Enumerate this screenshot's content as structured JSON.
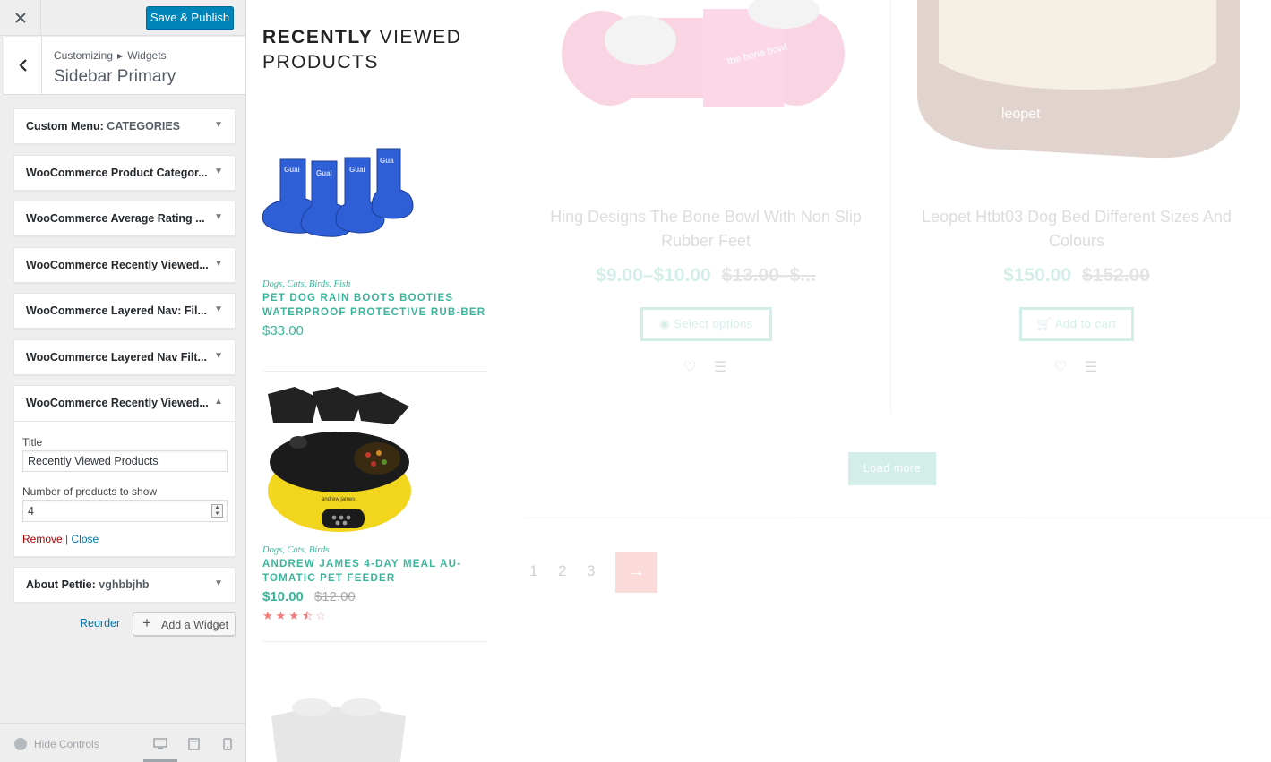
{
  "customizer": {
    "save_label": "Save & Publish",
    "breadcrumb": [
      "Customizing",
      "Widgets"
    ],
    "section_title": "Sidebar Primary",
    "widgets": [
      {
        "title": "Custom Menu:",
        "subtitle": "CATEGORIES"
      },
      {
        "title": "WooCommerce Product Categor...",
        "subtitle": ""
      },
      {
        "title": "WooCommerce Average Rating ...",
        "subtitle": ""
      },
      {
        "title": "WooCommerce Recently Viewed...",
        "subtitle": ""
      },
      {
        "title": "WooCommerce Layered Nav: Fil...",
        "subtitle": ""
      },
      {
        "title": "WooCommerce Layered Nav Filt...",
        "subtitle": ""
      },
      {
        "title": "WooCommerce Recently Viewed...",
        "subtitle": ""
      },
      {
        "title": "About Pettie:",
        "subtitle": "vghbbjhb"
      }
    ],
    "open_widget": {
      "title_label": "Title",
      "title_value": "Recently Viewed Products",
      "count_label": "Number of products to show",
      "count_value": "4",
      "remove_label": "Remove",
      "separator": "|",
      "close_label": "Close"
    },
    "reorder_label": "Reorder",
    "add_widget_label": "Add a Widget",
    "footer": {
      "hide_controls_label": "Hide Controls",
      "active_device": "desktop"
    }
  },
  "preview": {
    "recently_viewed": {
      "title_bold": "RECENTLY",
      "title_rest": " VIEWED PRODUCTS",
      "items": [
        {
          "categories": "Dogs, Cats, Birds, Fish",
          "name": "PET DOG RAIN BOOTS BOOTIES WATERPROOF PROTECTIVE RUB-BER",
          "price": "$33.00",
          "old_price": "",
          "image": "blue-rain-boots"
        },
        {
          "categories": "Dogs, Cats, Birds",
          "name": "ANDREW JAMES 4-DAY MEAL AU-TOMATIC PET FEEDER",
          "price": "$10.00",
          "old_price": "$12.00",
          "rating": 3.5,
          "image": "yellow-pet-feeder"
        }
      ]
    },
    "shop_grid": {
      "products": [
        {
          "name": "Hing Designs The Bone Bowl With Non Slip Rubber Feet",
          "price": "$9.00–$10.00",
          "old_price": "$13.00–$...",
          "button": "Select options",
          "button_icon": "eye-icon",
          "image_text": "the bone bowl"
        },
        {
          "name": "Leopet Htbt03 Dog Bed Different Sizes And Colours",
          "price": "$150.00",
          "old_price": "$152.00",
          "button": "Add to cart",
          "button_icon": "cart-icon",
          "image_text": "leopet"
        }
      ],
      "load_more": "Load more",
      "pages": [
        "1",
        "2",
        "3"
      ],
      "next_symbol": "→"
    },
    "colors": {
      "accent": "#3ab59b",
      "next_bg": "#f05a5a",
      "wp_blue": "#0085ba"
    }
  }
}
